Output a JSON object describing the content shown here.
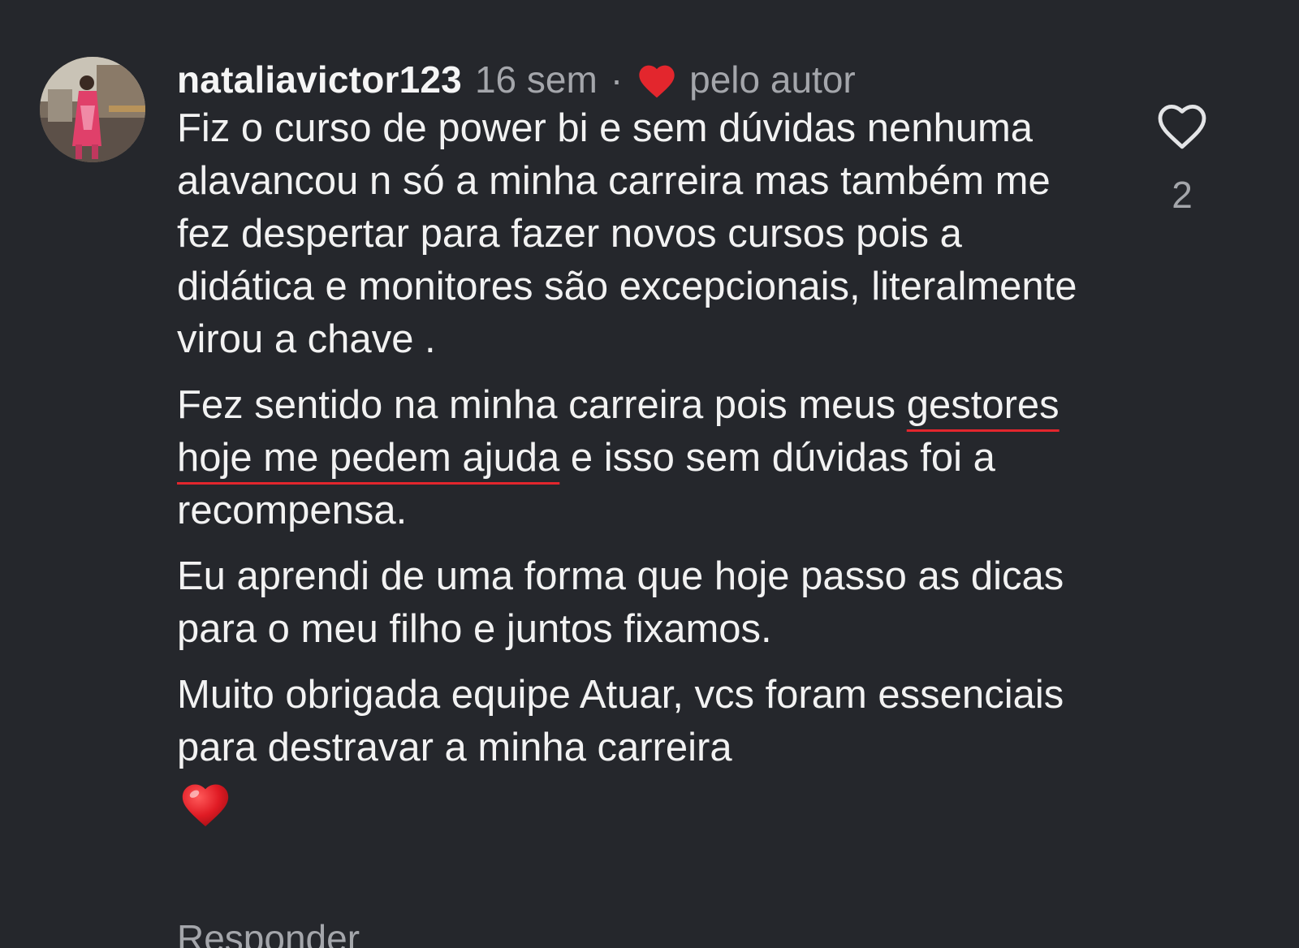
{
  "comment": {
    "username": "nataliavictor123",
    "time_ago": "16 sem",
    "separator": "·",
    "liked_by_author_label": "pelo autor",
    "paragraphs": {
      "p1": "Fiz o curso de power bi e sem dúvidas nenhuma alavancou n só a minha carreira mas também me fez despertar para fazer novos cursos pois a didática e monitores são excepcionais, literalmente virou a chave .",
      "p2_before": "Fez sentido na minha carreira pois meus ",
      "p2_highlight": "gestores hoje me pedem ajuda",
      "p2_after": " e isso sem dúvidas foi a recompensa.",
      "p3": "Eu aprendi de uma forma que hoje passo as dicas para o meu filho e juntos fixamos.",
      "p4": "Muito obrigada equipe Atuar, vcs foram essenciais para destravar a minha carreira"
    },
    "like_count": "2",
    "reply_peek": "Responder"
  },
  "icons": {
    "avatar": "profile-photo",
    "author_like": "heart-filled-icon",
    "emoji": "red-heart-emoji",
    "like_button": "heart-outline-icon"
  },
  "colors": {
    "background": "#25272c",
    "text": "#f2f2f2",
    "muted": "#a4a6ab",
    "heart_red": "#e3262d"
  }
}
